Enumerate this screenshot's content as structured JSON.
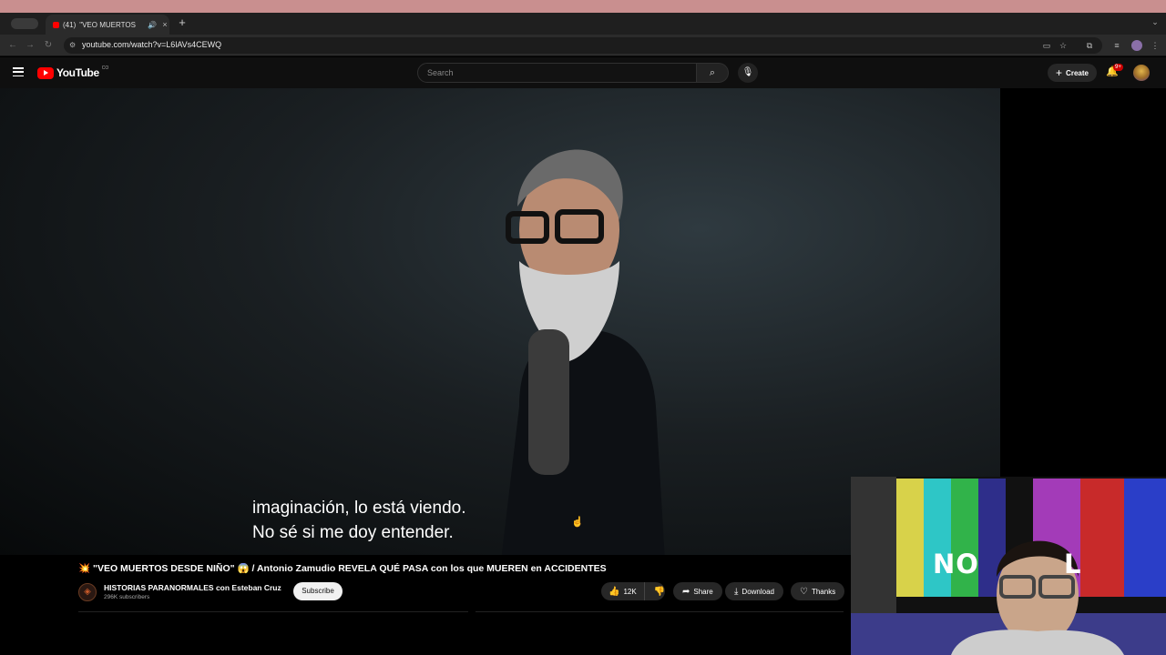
{
  "os": {
    "apple_icon": "apple-icon"
  },
  "browser": {
    "tab": {
      "count": "(41)",
      "title": "\"VEO MUERTOS",
      "audio_icon": "speaker-icon",
      "close": "×"
    },
    "new_tab": "+",
    "tab_menu": "⌄",
    "nav": {
      "back": "←",
      "forward": "→",
      "reload": "↻"
    },
    "url": "youtube.com/watch?v=L6lAVs4CEWQ"
  },
  "youtube": {
    "logo_text": "YouTube",
    "logo_country": "CO",
    "search_placeholder": "Search",
    "create_label": "Create",
    "notifications_badge": "9+"
  },
  "player": {
    "caption_line1": "imaginación, lo está viendo.",
    "caption_line2": "No sé si me doy entender."
  },
  "video": {
    "title": "💥 \"VEO MUERTOS DESDE NIÑO\" 😱 / Antonio Zamudio REVELA QUÉ PASA con los que MUEREN en ACCIDENTES",
    "channel_name": "HISTORIAS PARANORMALES con Esteban Cruz",
    "subscribers": "296K subscribers",
    "subscribe_label": "Subscribe",
    "likes": "12K",
    "share_label": "Share",
    "download_label": "Download",
    "thanks_label": "Thanks"
  },
  "webcam": {
    "overlay_text_left": "NO",
    "overlay_text_right": "L"
  }
}
